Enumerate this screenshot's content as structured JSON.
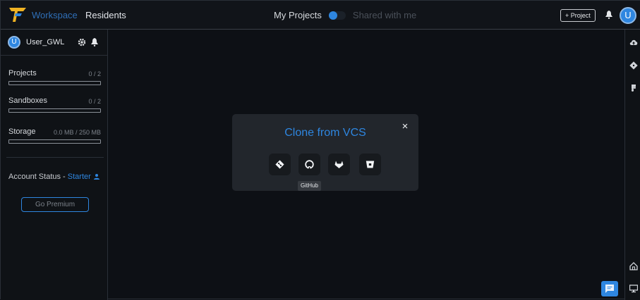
{
  "header": {
    "brand": "Workspace",
    "section": "Residents",
    "view_toggle": {
      "mine": "My Projects",
      "shared": "Shared with me"
    },
    "new_project_label": "+ Project",
    "avatar_initial": "U"
  },
  "sidebar": {
    "user": {
      "initial": "U",
      "name": "User_GWL"
    },
    "quotas": [
      {
        "label": "Projects",
        "value": "0 / 2",
        "used_fraction": 0
      },
      {
        "label": "Sandboxes",
        "value": "0 / 2",
        "used_fraction": 0
      },
      {
        "label": "Storage",
        "value": "0.0 MB / 250 MB",
        "used_fraction": 0
      }
    ],
    "account": {
      "prefix": "Account Status - ",
      "tier": "Starter"
    },
    "premium_label": "Go Premium"
  },
  "modal": {
    "title": "Clone from VCS",
    "close_symbol": "×",
    "providers": [
      {
        "icon": "git-icon"
      },
      {
        "icon": "github-icon"
      },
      {
        "icon": "gitlab-icon"
      },
      {
        "icon": "bitbucket-icon"
      }
    ],
    "tooltip": "GitHub"
  },
  "right_strip_icons": [
    "cloud-upload-icon",
    "git-icon",
    "figma-icon",
    "home-icon",
    "monitor-icon"
  ],
  "colors": {
    "accent": "#2e86e0",
    "background": "#0d1015",
    "panel": "#22262c"
  }
}
